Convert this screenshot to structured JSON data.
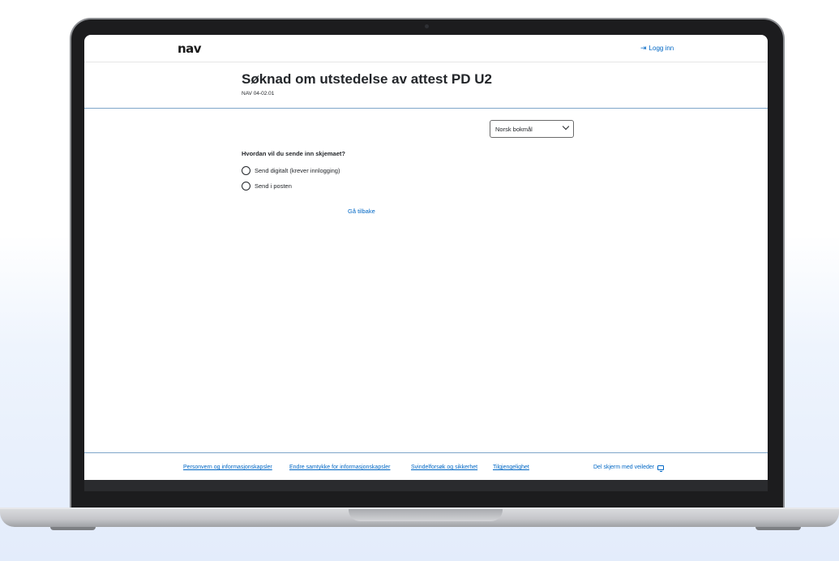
{
  "header": {
    "logo": "nav",
    "login_label": "Logg inn",
    "login_icon": "login-icon"
  },
  "page": {
    "title": "Søknad om utstedelse av attest PD U2",
    "form_id": "NAV 04-02.01"
  },
  "language_select": {
    "selected": "Norsk bokmål"
  },
  "form": {
    "question": "Hvordan vil du sende inn skjemaet?",
    "options": [
      {
        "label": "Send digitalt (krever innlogging)"
      },
      {
        "label": "Send i posten"
      }
    ],
    "back_label": "Gå tilbake"
  },
  "footer": {
    "links": [
      "Personvern og informasjonskapsler",
      "Endre samtykke for informasjonskapsler",
      "Svindelforsøk og sikkerhet",
      "Tilgjengelighet"
    ],
    "share_screen_label": "Del skjerm med veileder",
    "share_screen_icon": "monitor-icon"
  },
  "colors": {
    "link": "#0067c5",
    "text": "#23262a",
    "divider": "#7fa6c9"
  }
}
